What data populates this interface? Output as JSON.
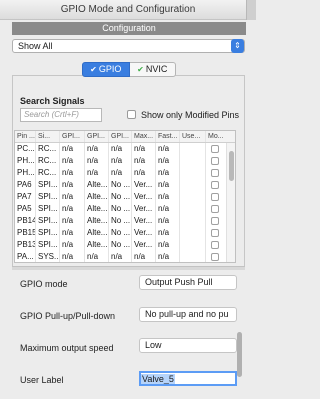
{
  "window": {
    "title": "GPIO Mode and Configuration"
  },
  "config_header": "Configuration",
  "filter_select": {
    "value": "Show All",
    "arrow_icon": "chevron-updown-icon"
  },
  "tabs": [
    {
      "label": "GPIO",
      "icon": "check-circle-icon",
      "active": true
    },
    {
      "label": "NVIC",
      "icon": "check-circle-icon",
      "active": false
    }
  ],
  "search": {
    "label": "Search Signals",
    "placeholder": "Search (Crtl+F)",
    "modified_only_label": "Show only Modified Pins"
  },
  "table": {
    "headers": [
      "Pin ...",
      "Si...",
      "GPI...",
      "GPI...",
      "GPI...",
      "Max...",
      "Fast...",
      "Use...",
      "Mo..."
    ],
    "rows": [
      [
        "PC...",
        "RC...",
        "n/a",
        "n/a",
        "n/a",
        "n/a",
        "n/a",
        "",
        ""
      ],
      [
        "PH...",
        "RC...",
        "n/a",
        "n/a",
        "n/a",
        "n/a",
        "n/a",
        "",
        ""
      ],
      [
        "PH...",
        "RC...",
        "n/a",
        "n/a",
        "n/a",
        "n/a",
        "n/a",
        "",
        ""
      ],
      [
        "PA6",
        "SPI...",
        "n/a",
        "Alte...",
        "No ...",
        "Ver...",
        "n/a",
        "",
        ""
      ],
      [
        "PA7",
        "SPI...",
        "n/a",
        "Alte...",
        "No ...",
        "Ver...",
        "n/a",
        "",
        ""
      ],
      [
        "PA5",
        "SPI...",
        "n/a",
        "Alte...",
        "No ...",
        "Ver...",
        "n/a",
        "",
        ""
      ],
      [
        "PB14",
        "SPI...",
        "n/a",
        "Alte...",
        "No ...",
        "Ver...",
        "n/a",
        "",
        ""
      ],
      [
        "PB15",
        "SPI...",
        "n/a",
        "Alte...",
        "No ...",
        "Ver...",
        "n/a",
        "",
        ""
      ],
      [
        "PB13",
        "SPI...",
        "n/a",
        "Alte...",
        "No ...",
        "Ver...",
        "n/a",
        "",
        ""
      ],
      [
        "PA...",
        "SYS...",
        "n/a",
        "n/a",
        "n/a",
        "n/a",
        "n/a",
        "",
        ""
      ]
    ]
  },
  "properties": {
    "gpio_mode": {
      "label": "GPIO mode",
      "value": "Output Push Pull"
    },
    "pull": {
      "label": "GPIO Pull-up/Pull-down",
      "value": "No pull-up and no pu"
    },
    "speed": {
      "label": "Maximum output speed",
      "value": "Low"
    },
    "user_label": {
      "label": "User Label",
      "value": "Valve_5"
    }
  }
}
